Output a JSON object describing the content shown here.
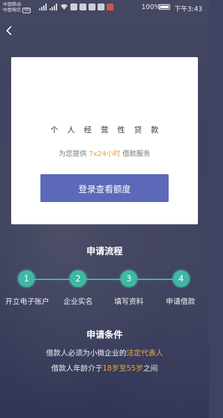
{
  "status_bar": {
    "carrier_1": "中国移动",
    "carrier_2": "中国电信",
    "carrier_2_badge": "HD",
    "battery_percent": "100%",
    "time": "下午3:43"
  },
  "card": {
    "title": "个人经营性贷款",
    "subtitle_prefix": "为您提供",
    "subtitle_highlight": "7x24小时",
    "subtitle_suffix": "借款服务",
    "login_button": "登录查看额度"
  },
  "process": {
    "title": "申请流程",
    "steps": [
      {
        "num": "1",
        "label": "开立电子账户"
      },
      {
        "num": "2",
        "label": "企业实名"
      },
      {
        "num": "3",
        "label": "填写资料"
      },
      {
        "num": "4",
        "label": "申请借款"
      }
    ]
  },
  "conditions": {
    "title": "申请条件",
    "line1_prefix": "借款人必须为小微企业的",
    "line1_highlight": "法定代表人",
    "line2_prefix": "借款人年龄介于",
    "line2_highlight": "18岁至55岁",
    "line2_suffix": "之间"
  },
  "colors": {
    "accent_button": "#5b69b8",
    "step_teal": "#3fb8a4",
    "highlight_orange": "#f2a93b"
  }
}
